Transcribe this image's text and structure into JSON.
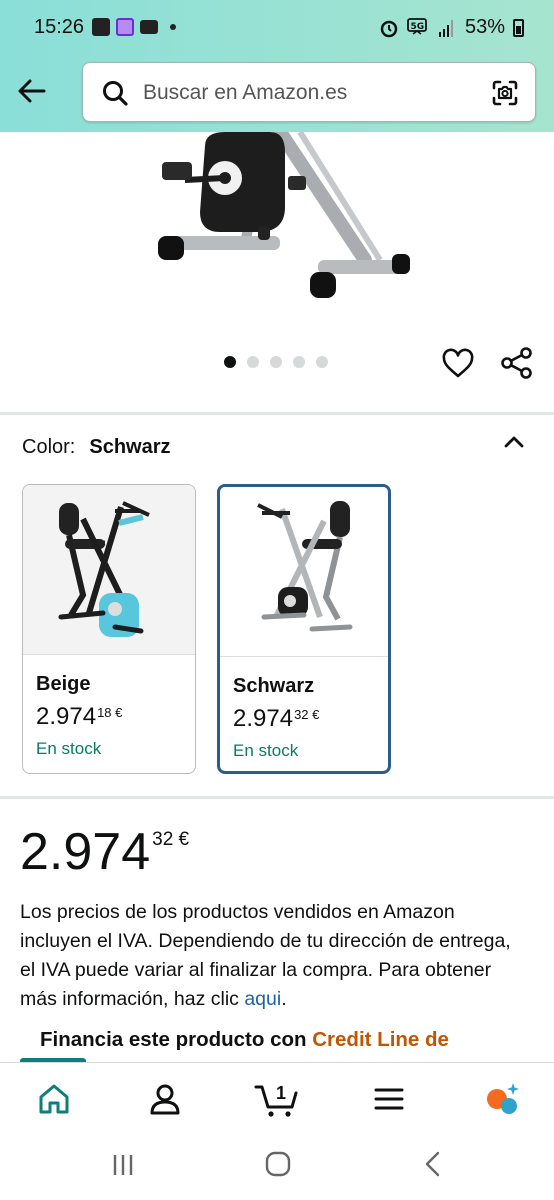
{
  "status_bar": {
    "time": "15:26",
    "battery": "53%",
    "left_icons": [
      "gallery-icon",
      "app-notification-icon",
      "mail-icon",
      "dot-icon"
    ],
    "right_icons": [
      "alarm-icon",
      "5g-icon",
      "signal-icon",
      "battery-icon"
    ]
  },
  "search": {
    "placeholder": "Buscar en Amazon.es"
  },
  "gallery": {
    "image_count": 5,
    "active_index": 0
  },
  "color_section": {
    "label": "Color:",
    "selected": "Schwarz",
    "options": [
      {
        "name": "Beige",
        "price_whole": "2.974",
        "price_fraction": "18 €",
        "stock": "En stock"
      },
      {
        "name": "Schwarz",
        "price_whole": "2.974",
        "price_fraction": "32 €",
        "stock": "En stock"
      }
    ]
  },
  "price": {
    "whole": "2.974",
    "fraction": "32 €"
  },
  "tax_notice": {
    "text": "Los precios de los productos vendidos en Amazon incluyen el IVA. Dependiendo de tu dirección de entrega, el IVA puede variar al finalizar la compra. Para obtener más información, haz clic ",
    "link": "aqui",
    "end": "."
  },
  "finance": {
    "text": "Financia este producto con ",
    "link": "Credit Line de"
  },
  "bottom_nav": {
    "cart_count": "1",
    "items": [
      "home-icon",
      "account-icon",
      "cart-icon",
      "menu-icon",
      "rufus-icon"
    ],
    "active": "home-icon"
  },
  "colors": {
    "header_gradient_start": "#8adfd8",
    "header_gradient_end": "#a6e4cf",
    "link": "#2162a1",
    "stock_green": "#067d62",
    "finance_orange": "#c45500",
    "selected_border": "#2a5d8c",
    "nav_active": "#0f7d7a"
  }
}
